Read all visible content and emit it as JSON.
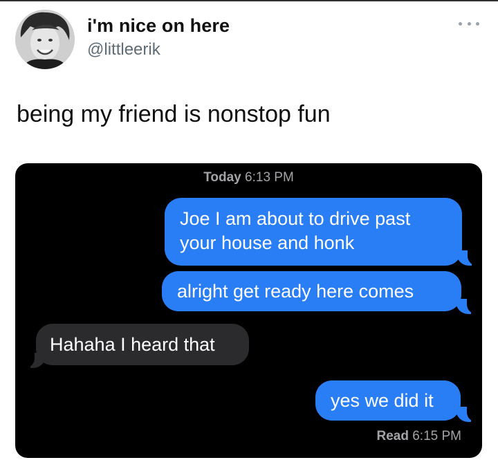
{
  "tweet": {
    "display_name": "i'm nice on here",
    "handle": "@littleerik",
    "text": "being my friend is nonstop fun",
    "more_icon": "more-horizontal-icon"
  },
  "conversation": {
    "timestamp_day": "Today",
    "timestamp_time": "6:13 PM",
    "messages": [
      {
        "direction": "outgoing",
        "line1": "Joe I am about to drive past",
        "line2": "your house and honk"
      },
      {
        "direction": "outgoing",
        "text": "alright get ready here comes"
      },
      {
        "direction": "incoming",
        "text": "Hahaha I heard that"
      },
      {
        "direction": "outgoing",
        "text": "yes we did it"
      }
    ],
    "read_label": "Read",
    "read_time": "6:15 PM"
  },
  "colors": {
    "outgoing_bubble": "#2a7ef5",
    "incoming_bubble": "#2b2b2d",
    "media_background": "#000000",
    "handle_text": "#5f6b75"
  }
}
